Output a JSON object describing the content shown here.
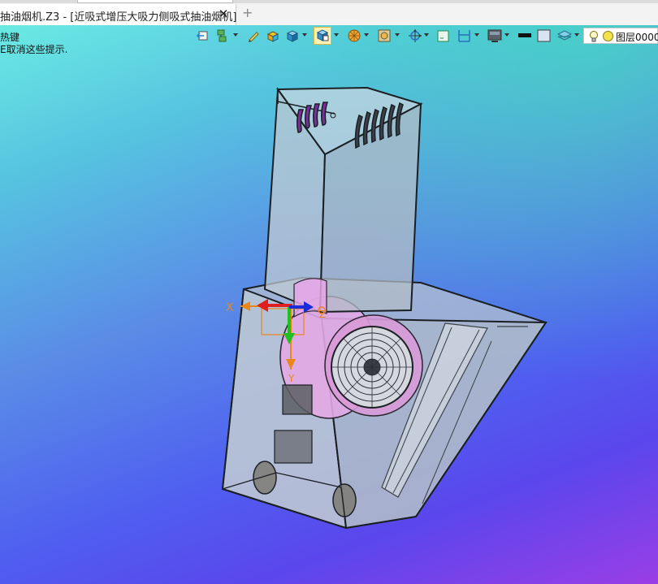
{
  "document_tab": {
    "title": "抽油烟机.Z3 - [近吸式增压大吸力侧吸式抽油烟机]",
    "close_glyph": "✕",
    "new_tab_glyph": "+"
  },
  "hints": {
    "line1": "热键",
    "line2": "E取消这些提示."
  },
  "toolbar": {
    "icons": [
      "exit-part-icon",
      "history-icon",
      "pen-icon",
      "box-icon",
      "cube-view-icon",
      "display-mode-icon",
      "render-icon",
      "material-icon",
      "view-icon",
      "frame-icon",
      "dimension-icon",
      "background-icon",
      "color-black-icon",
      "color-light-icon",
      "layer-stack-icon"
    ],
    "layer": {
      "name": "图层0000"
    }
  },
  "triad": {
    "x_label": "X",
    "y_label": "Y",
    "z_label": "Z"
  },
  "colors": {
    "viewport_top": "#6ef0e4",
    "viewport_mid": "#4f5ff0",
    "viewport_bottom": "#9a3ee6",
    "axis_x": "#e02020",
    "axis_y": "#20c020",
    "axis_z": "#1a2cd8",
    "triad_handle": "#e8881a",
    "motor": "#e2a8e4"
  }
}
